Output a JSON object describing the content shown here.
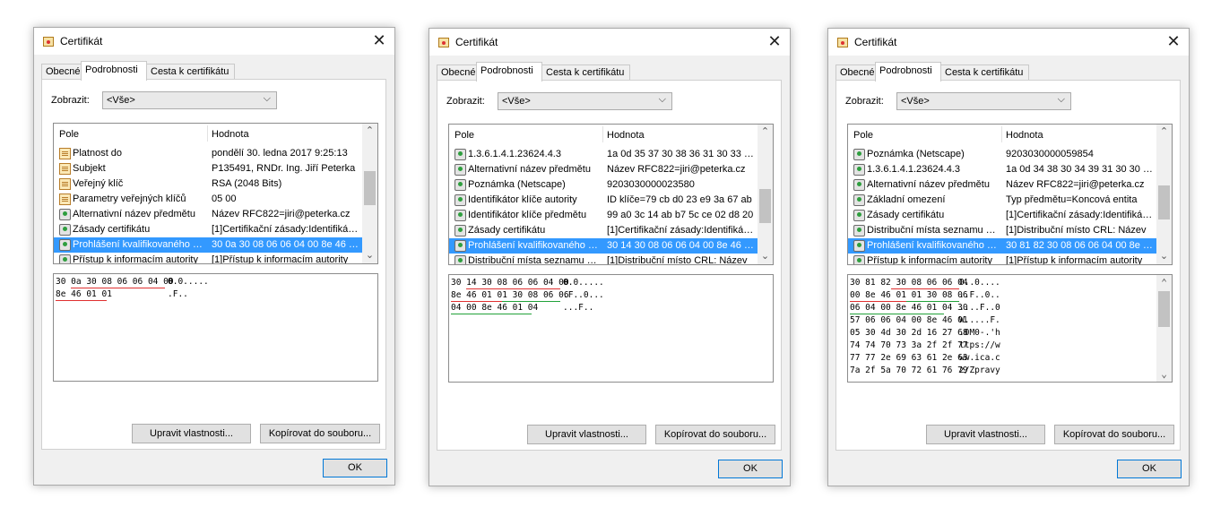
{
  "dialogs": [
    {
      "title": "Certifikát",
      "tabs": [
        "Obecné",
        "Podrobnosti",
        "Cesta k certifikátu"
      ],
      "show_label": "Zobrazit:",
      "show_value": "<Vše>",
      "col_field": "Pole",
      "col_value": "Hodnota",
      "rows": [
        {
          "icon": "document-icon",
          "field": "Platnost do",
          "value": "pondělí 30. ledna 2017 9:25:13"
        },
        {
          "icon": "document-icon",
          "field": "Subjekt",
          "value": "P135491, RNDr. Ing. Jiří Peterka"
        },
        {
          "icon": "document-icon",
          "field": "Veřejný klíč",
          "value": "RSA (2048 Bits)"
        },
        {
          "icon": "document-icon",
          "field": "Parametry veřejných klíčů",
          "value": "05 00"
        },
        {
          "icon": "extension-icon",
          "field": "Alternativní název předmětu",
          "value": "Název RFC822=jiri@peterka.cz"
        },
        {
          "icon": "extension-icon",
          "field": "Zásady certifikátu",
          "value": "[1]Certifikační zásady:Identifikátor"
        },
        {
          "icon": "extension-icon",
          "field": "Prohlášení kvalifikovaného certifikátu",
          "value": "30 0a 30 08 06 06 04 00 8e 46 01 01",
          "selected": true
        },
        {
          "icon": "extension-icon",
          "field": "Přístup k informacím autority",
          "value": "[1]Přístup k informacím autority"
        }
      ],
      "hex": [
        {
          "hex": "30 0a 30 08 06 06 04 00",
          "ascii": "0.0....."
        },
        {
          "hex": "8e 46 01 01",
          "ascii": ".F.."
        }
      ],
      "btn_edit": "Upravit vlastnosti...",
      "btn_copy": "Kopírovat do souboru...",
      "btn_ok": "OK"
    },
    {
      "title": "Certifikát",
      "tabs": [
        "Obecné",
        "Podrobnosti",
        "Cesta k certifikátu"
      ],
      "show_label": "Zobrazit:",
      "show_value": "<Vše>",
      "col_field": "Pole",
      "col_value": "Hodnota",
      "rows": [
        {
          "icon": "extension-icon",
          "field": "1.3.6.1.4.1.23624.4.3",
          "value": "1a 0d 35 37 30 38 36 31 30 33 30 30"
        },
        {
          "icon": "extension-icon",
          "field": "Alternativní název předmětu",
          "value": "Název RFC822=jiri@peterka.cz"
        },
        {
          "icon": "extension-icon",
          "field": "Poznámka (Netscape)",
          "value": "9203030000023580"
        },
        {
          "icon": "extension-icon",
          "field": "Identifikátor klíče autority",
          "value": "ID klíče=79 cb d0 23 e9 3a 67 ab"
        },
        {
          "icon": "extension-icon",
          "field": "Identifikátor klíče předmětu",
          "value": "99 a0 3c 14 ab b7 5c ce 02 d8 20"
        },
        {
          "icon": "extension-icon",
          "field": "Zásady certifikátu",
          "value": "[1]Certifikační zásady:Identifikátor"
        },
        {
          "icon": "extension-icon",
          "field": "Prohlášení kvalifikovaného certifikátu",
          "value": "30 14 30 08 06 06 04 00 8e 46 01 01",
          "selected": true
        },
        {
          "icon": "extension-icon",
          "field": "Distribuční místa seznamu odvolaných",
          "value": "[1]Distribuční místo CRL: Název"
        }
      ],
      "hex": [
        {
          "hex": "30 14 30 08 06 06 04 00",
          "ascii": "0.0....."
        },
        {
          "hex": "8e 46 01 01 30 08 06 06",
          "ascii": ".F..0..."
        },
        {
          "hex": "04 00 8e 46 01 04",
          "ascii": "...F.."
        }
      ],
      "btn_edit": "Upravit vlastnosti...",
      "btn_copy": "Kopírovat do souboru...",
      "btn_ok": "OK"
    },
    {
      "title": "Certifikát",
      "tabs": [
        "Obecné",
        "Podrobnosti",
        "Cesta k certifikátu"
      ],
      "show_label": "Zobrazit:",
      "show_value": "<Vše>",
      "col_field": "Pole",
      "col_value": "Hodnota",
      "rows": [
        {
          "icon": "extension-icon",
          "field": "Poznámka (Netscape)",
          "value": "9203030000059854"
        },
        {
          "icon": "extension-icon",
          "field": "1.3.6.1.4.1.23624.4.3",
          "value": "1a 0d 34 38 30 34 39 31 30 30 30 30"
        },
        {
          "icon": "extension-icon",
          "field": "Alternativní název předmětu",
          "value": "Název RFC822=jiri@peterka.cz"
        },
        {
          "icon": "extension-icon",
          "field": "Základní omezení",
          "value": "Typ předmětu=Koncová entita"
        },
        {
          "icon": "extension-icon",
          "field": "Zásady certifikátu",
          "value": "[1]Certifikační zásady:Identifikátor"
        },
        {
          "icon": "extension-icon",
          "field": "Distribuční místa seznamu odvolaných",
          "value": "[1]Distribuční místo CRL: Název"
        },
        {
          "icon": "extension-icon",
          "field": "Prohlášení kvalifikovaného certifikátu",
          "value": "30 81 82 30 08 06 06 04 00 8e 46",
          "selected": true
        },
        {
          "icon": "extension-icon",
          "field": "Přístup k informacím autority",
          "value": "[1]Přístup k informacím autority"
        }
      ],
      "hex": [
        {
          "hex": "30 81 82 30 08 06 06 04",
          "ascii": "0..0...."
        },
        {
          "hex": "00 8e 46 01 01 30 08 06",
          "ascii": "..F..0.."
        },
        {
          "hex": "06 04 00 8e 46 01 04 30",
          "ascii": "....F..0"
        },
        {
          "hex": "57 06 06 04 00 8e 46 01",
          "ascii": "W.....F."
        },
        {
          "hex": "05 30 4d 30 2d 16 27 68",
          "ascii": ".0M0-.'h"
        },
        {
          "hex": "74 74 70 73 3a 2f 2f 77",
          "ascii": "ttps://w"
        },
        {
          "hex": "77 77 2e 69 63 61 2e 63",
          "ascii": "ww.ica.c"
        },
        {
          "hex": "7a 2f 5a 70 72 61 76 79",
          "ascii": "z/Zpravy"
        }
      ],
      "btn_edit": "Upravit vlastnosti...",
      "btn_copy": "Kopírovat do souboru...",
      "btn_ok": "OK"
    }
  ],
  "colors": {
    "selection": "#3399ff",
    "underline_red": "#e03030",
    "underline_green": "#22a23a",
    "ok_border": "#0078d7"
  }
}
